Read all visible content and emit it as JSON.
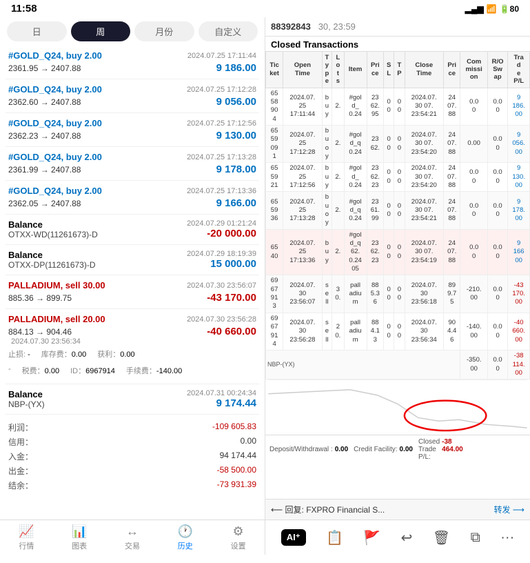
{
  "statusBar": {
    "time": "11:58",
    "signal": "▂▄▆",
    "wifi": "WiFi",
    "battery": "80"
  },
  "rightHeader": {
    "accountNum": "88392843",
    "date": "30, 23:59"
  },
  "closedTitle": "Closed Transactions",
  "tabs": [
    {
      "id": "ri",
      "label": "日",
      "active": false
    },
    {
      "id": "zhou",
      "label": "周",
      "active": true
    },
    {
      "id": "yuefen",
      "label": "月份",
      "active": false
    },
    {
      "id": "ziding",
      "label": "自定义",
      "active": false
    }
  ],
  "tableHeaders": [
    {
      "key": "ticket",
      "label": "Tic\nket"
    },
    {
      "key": "openTime",
      "label": "Open\nTime"
    },
    {
      "key": "type",
      "label": "T\ny\np\ne"
    },
    {
      "key": "lots",
      "label": "L\no\nt\ns"
    },
    {
      "key": "item",
      "label": "Item"
    },
    {
      "key": "price",
      "label": "Pri\nce"
    },
    {
      "key": "sl",
      "label": "S\nL"
    },
    {
      "key": "tp",
      "label": "T\nP"
    },
    {
      "key": "closeTime",
      "label": "Close\nTime"
    },
    {
      "key": "closePrice",
      "label": "Pri\nce"
    },
    {
      "key": "commission",
      "label": "Com\nmissi\non"
    },
    {
      "key": "swap",
      "label": "R/O\nSw\nap"
    },
    {
      "key": "pnl",
      "label": "Tra\nd\ne\nP/L"
    }
  ],
  "tableRows": [
    {
      "ticket": "65\n58\n90\n4",
      "openTime": "2024.07.\n25\n17:11:44",
      "type": "b\nu\ny",
      "lots": "2.",
      "item": "#gol\nd_\n0.24",
      "price": "23\n62.\n95\n0",
      "sl": "0\n0",
      "tp": "0\n0",
      "closeTime": "2024.07.\n30 07.\n23:54:21",
      "closePrice": "24\n07.\n88",
      "commission": "0.0\n0",
      "swap": "0.0\n0",
      "pnl": "9\n186.\n00",
      "pnlClass": "blue"
    },
    {
      "ticket": "65\n59\n09\n1",
      "openTime": "2024.07.\n25\n17:12:28",
      "type": "b\nu\no\ny",
      "lots": "2.",
      "item": "#gol\nd_q\n0.24",
      "price": "23\n62.\n0",
      "sl": "0\n0",
      "tp": "0\n0",
      "closeTime": "2024.07.\n30 07.\n23:54:20",
      "closePrice": "24\n07.\n88",
      "commission": "0.00",
      "swap": "0.0\n0",
      "pnl": "9\n056.\n00",
      "pnlClass": "blue"
    },
    {
      "ticket": "65\n59\n21",
      "openTime": "2024.07.\n25\n17:12:56",
      "type": "b\nu\ny",
      "lots": "2.",
      "item": "#gol\nd_\ny\n0.24",
      "price": "23\n62.\n23",
      "sl": "0\n0",
      "tp": "0\n0",
      "closeTime": "2024.07.\n30 07.\n23:54:20",
      "closePrice": "24\n07.\n88",
      "commission": "0.0\n0",
      "swap": "0.0\n0",
      "pnl": "9\n130.\n00",
      "pnlClass": "blue"
    },
    {
      "ticket": "65\n59\n36",
      "openTime": "2024.07.\n25\n17:13:28",
      "type": "b\nu\no\ny",
      "lots": "2.",
      "item": "#gol\nd_q\ny\n0.24",
      "price": "23\n61.\n99\n0",
      "sl": "0\n0",
      "tp": "0\n0",
      "closeTime": "2024.07.\n30 07.\n23:54:21",
      "closePrice": "24\n07.\n88",
      "commission": "0.0\n0",
      "swap": "0.0\n0",
      "pnl": "9\n178.\n00",
      "pnlClass": "blue"
    },
    {
      "ticket": "65\n40",
      "openTime": "2024.07.\n25\n17:13:36",
      "type": "b\nu\ny",
      "lots": "2.",
      "item": "#gol\nd_q\n62.\n0.24\n05\n0\n0",
      "price": "23\n62.\n23\n05",
      "sl": "0\n0",
      "tp": "0\n0",
      "closeTime": "2024.07.\n30 07.\n23:54:19",
      "closePrice": "24\n07.\n88",
      "commission": "0.0\n0",
      "swap": "0.0\n0",
      "pnl": "9\n166\n00",
      "pnlClass": "blue",
      "highlight": true
    },
    {
      "ticket": "69\n67\n91\n3",
      "openTime": "2024.07.\n30\n23:56:07",
      "type": "s\ne\nll",
      "lots": "3\n0.",
      "item": "pall\nadiu\nm",
      "price": "88\n5.3\n6\n0\n0",
      "sl": "0\n0",
      "tp": "0\n0",
      "closeTime": "2024.07.\n30\n23:56:18",
      "closePrice": "89\n9.7\n5",
      "commission": "-210.\n00",
      "swap": "0.0\n0",
      "pnl": "-43\n170.\n00",
      "pnlClass": "red"
    },
    {
      "ticket": "69\n67\n91\n4",
      "openTime": "2024.07.\n30\n23:56:28",
      "type": "s\ne\nll",
      "lots": "2\n0.",
      "item": "pall\nadiu\nm",
      "price": "88\n4.1\n3\n0\n0",
      "sl": "0\n0",
      "tp": "0\n0",
      "closeTime": "2024.07.\n30\n23:56:34",
      "closePrice": "90\n4.4\n6",
      "commission": "-140.\n00",
      "swap": "0.0\n0",
      "pnl": "-40\n660.\n00",
      "pnlClass": "red"
    },
    {
      "ticket": "",
      "openTime": "",
      "type": "",
      "lots": "",
      "item": "",
      "price": "",
      "sl": "",
      "tp": "",
      "closeTime": "",
      "closePrice": "",
      "commission": "-350.\n00",
      "swap": "0.0\n0",
      "pnl": "-38\n114.\n00",
      "pnlClass": "red",
      "isBalance": true,
      "balanceLabel": "NBP-(YX)"
    }
  ],
  "bottomSummary": {
    "deposit": "Deposit/Withdrawal\n: 0.00",
    "credit": "Credit Facility: 0.00",
    "closed": "Closed\nTrade\nP/L:",
    "closedVal": "-38\n464.00"
  },
  "replyBar": {
    "replyText": "⟵ 回复: FXPRO Financial S...",
    "forwardText": "转发 ⟶"
  },
  "leftTransactions": [
    {
      "id": "tx1",
      "title": "#GOLD_Q24, buy 2.00",
      "titleClass": "buy",
      "date": "2024.07.25 17:11:44",
      "prices": "2361.95 → 2407.88",
      "pnl": "9 186.00",
      "pnlClass": "positive"
    },
    {
      "id": "tx2",
      "title": "#GOLD_Q24, buy 2.00",
      "titleClass": "buy",
      "date": "2024.07.25 17:12:28",
      "prices": "2362.60 → 2407.88",
      "pnl": "9 056.00",
      "pnlClass": "positive"
    },
    {
      "id": "tx3",
      "title": "#GOLD_Q24, buy 2.00",
      "titleClass": "buy",
      "date": "2024.07.25 17:12:56",
      "prices": "2362.23 → 2407.88",
      "pnl": "9 130.00",
      "pnlClass": "positive"
    },
    {
      "id": "tx4",
      "title": "#GOLD_Q24, buy 2.00",
      "titleClass": "buy",
      "date": "2024.07.25 17:13:28",
      "prices": "2361.99 → 2407.88",
      "pnl": "9 178.00",
      "pnlClass": "positive"
    },
    {
      "id": "tx5",
      "title": "#GOLD_Q24, buy 2.00",
      "titleClass": "buy",
      "date": "2024.07.25 17:13:36",
      "prices": "2362.05 → 2407.88",
      "pnl": "9 166.00",
      "pnlClass": "positive"
    },
    {
      "id": "bal1",
      "isBalance": true,
      "title": "Balance",
      "subtitle": "OTXX-WD(11261673)-D",
      "date": "2024.07.29 01:21:24",
      "pnl": "-20 000.00",
      "pnlClass": "negative"
    },
    {
      "id": "bal2",
      "isBalance": true,
      "title": "Balance",
      "subtitle": "OTXX-DP(11261673)-D",
      "date": "2024.07.29 18:19:39",
      "pnl": "15 000.00",
      "pnlClass": "positive"
    },
    {
      "id": "tx6",
      "title": "PALLADIUM, sell 30.00",
      "titleClass": "sell",
      "date": "2024.07.30 23:56:07",
      "prices": "885.36 → 899.75",
      "pnl": "-43 170.00",
      "pnlClass": "negative"
    },
    {
      "id": "tx7",
      "title": "PALLADIUM, sell 20.00",
      "titleClass": "sell",
      "date": "2024.07.30 23:56:28",
      "prices": "884.13 → 904.46",
      "pnl": "-40 660.00",
      "pnlClass": "negative",
      "hasDetail": true,
      "detailDate": "2024.07.30 23:56:34",
      "stopLoss": "-",
      "storage": "库存费：",
      "storageVal": "0.00",
      "profit": "获利：",
      "profitVal": "0.00",
      "tax": "税费：",
      "taxVal": "0.00",
      "id2": "ID：",
      "idVal": "6967914",
      "cont": "手续费：",
      "contVal": "-140.00"
    }
  ],
  "leftSummary": {
    "profitLabel": "利润：",
    "profitVal": "-109 605.83",
    "creditLabel": "信用：",
    "creditVal": "0.00",
    "depositLabel": "入金：",
    "depositVal": "94 174.44",
    "withdrawLabel": "出金：",
    "withdrawVal": "-58 500.00",
    "balanceLabel": "结余：",
    "balanceVal": "-73 931.39"
  },
  "balanceEntry": {
    "title": "Balance",
    "subtitle": "NBP-(YX)",
    "date": "2024.07.31 00:24:34",
    "pnl": "9 174.44",
    "pnlClass": "positive"
  },
  "bottomNav": [
    {
      "id": "market",
      "label": "行情",
      "icon": "📈",
      "active": false
    },
    {
      "id": "chart",
      "label": "图表",
      "icon": "📊",
      "active": false
    },
    {
      "id": "trade",
      "label": "交易",
      "icon": "↔",
      "active": false
    },
    {
      "id": "history",
      "label": "历史",
      "icon": "🕐",
      "active": true
    },
    {
      "id": "settings",
      "label": "设置",
      "icon": "⚙",
      "active": false
    }
  ],
  "toolbar": [
    {
      "id": "ai",
      "label": "AI⁺",
      "icon": "AI⁺"
    },
    {
      "id": "folder",
      "label": "",
      "icon": "📁"
    },
    {
      "id": "flag",
      "label": "",
      "icon": "🚩"
    },
    {
      "id": "cycle",
      "label": "",
      "icon": "↩"
    },
    {
      "id": "trash",
      "label": "",
      "icon": "🗑"
    },
    {
      "id": "copy",
      "label": "",
      "icon": "⧉"
    },
    {
      "id": "more",
      "label": "",
      "icon": "···"
    }
  ]
}
